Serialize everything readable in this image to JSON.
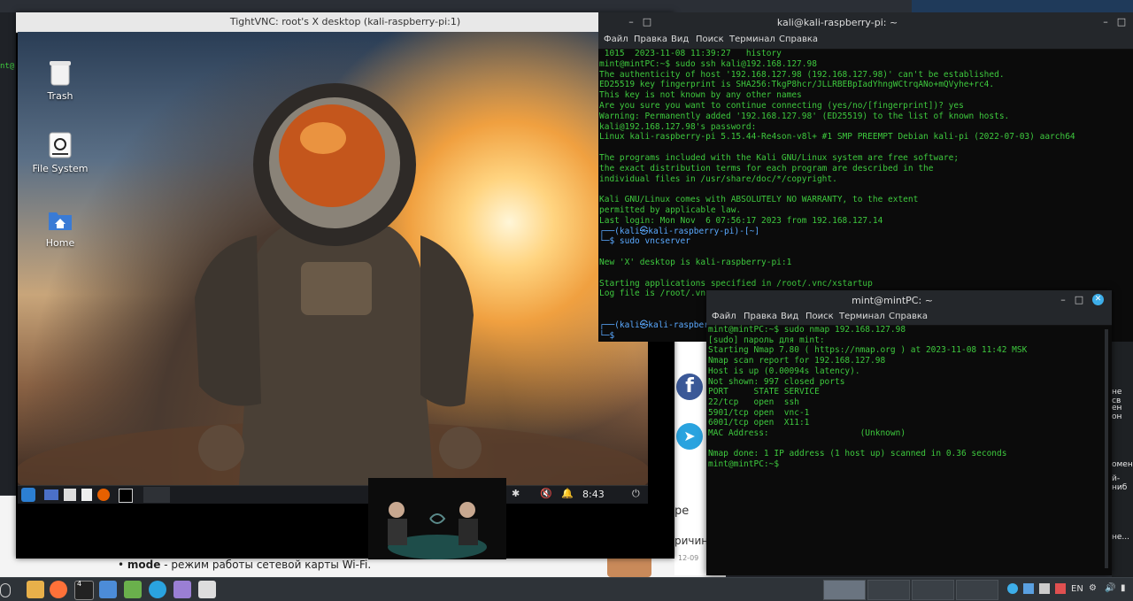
{
  "vnc": {
    "title": "TightVNC: root's X desktop (kali-raspberry-pi:1)",
    "desktop_icons": [
      {
        "label": "Trash",
        "icon": "trash-icon"
      },
      {
        "label": "File System",
        "icon": "drive-icon"
      },
      {
        "label": "Home",
        "icon": "home-folder-icon"
      }
    ],
    "panel_clock": "8:43"
  },
  "terminal1": {
    "title": "kali@kali-raspberry-pi: ~",
    "menu": [
      "Файл",
      "Правка",
      "Вид",
      "Поиск",
      "Терминал",
      "Справка"
    ],
    "lines": [
      " 1015  2023-11-08 11:39:27   history",
      "mint@mintPC:~$ sudo ssh kali@192.168.127.98",
      "The authenticity of host '192.168.127.98 (192.168.127.98)' can't be established.",
      "ED25519 key fingerprint is SHA256:TkgP8hcr/JLLRBEBpIadYhngWCtrqANo+mQVyhe+rc4.",
      "This key is not known by any other names",
      "Are you sure you want to continue connecting (yes/no/[fingerprint])? yes",
      "Warning: Permanently added '192.168.127.98' (ED25519) to the list of known hosts.",
      "kali@192.168.127.98's password:",
      "Linux kali-raspberry-pi 5.15.44-Re4son-v8l+ #1 SMP PREEMPT Debian kali-pi (2022-07-03) aarch64",
      "",
      "The programs included with the Kali GNU/Linux system are free software;",
      "the exact distribution terms for each program are described in the",
      "individual files in /usr/share/doc/*/copyright.",
      "",
      "Kali GNU/Linux comes with ABSOLUTELY NO WARRANTY, to the extent",
      "permitted by applicable law.",
      "Last login: Mon Nov  6 07:56:17 2023 from 192.168.127.14",
      "┌──(kali㉿kali-raspberry-pi)-[~]",
      "└─$ sudo vncserver",
      "",
      "New 'X' desktop is kali-raspberry-pi:1",
      "",
      "Starting applications specified in /root/.vnc/xstartup",
      "Log file is /root/.vnc",
      "",
      "",
      "┌──(kali㉿kali-raspberr",
      "└─$"
    ]
  },
  "terminal2": {
    "title": "mint@mintPC: ~",
    "menu": [
      "Файл",
      "Правка",
      "Вид",
      "Поиск",
      "Терминал",
      "Справка"
    ],
    "lines": [
      "mint@mintPC:~$ sudo nmap 192.168.127.98",
      "[sudo] пароль для mint:",
      "Starting Nmap 7.80 ( https://nmap.org ) at 2023-11-08 11:42 MSK",
      "Nmap scan report for 192.168.127.98",
      "Host is up (0.00094s latency).",
      "Not shown: 997 closed ports",
      "PORT     STATE SERVICE",
      "22/tcp   open  ssh",
      "5901/tcp open  vnc-1",
      "6001/tcp open  X11:1",
      "MAC Address:                  (Unknown)",
      "",
      "Nmap done: 1 IP address (1 host up) scanned in 0.36 seconds",
      "mint@mintPC:~$"
    ]
  },
  "background": {
    "bullet_term": "mode",
    "bullet_text": " - режим работы сетевой карты Wi-Fi.",
    "snippet_1": "ре",
    "snippet_2": "ричин",
    "snippet_3": "12-09",
    "right_snips": [
      "не св",
      "ен он",
      "омен",
      "й-ниб",
      "не..."
    ]
  },
  "taskbar": {
    "lang": "EN",
    "badge": "4"
  }
}
